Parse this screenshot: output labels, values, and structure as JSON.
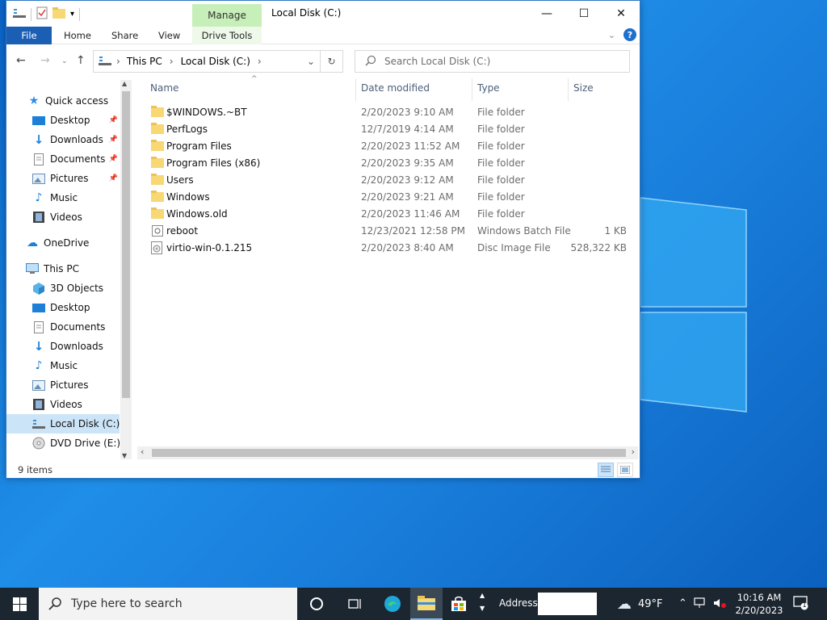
{
  "window": {
    "title": "Local Disk (C:)",
    "manage_tab": "Manage"
  },
  "ribbon": {
    "tabs": [
      "File",
      "Home",
      "Share",
      "View"
    ],
    "drive_tools": "Drive Tools"
  },
  "navigation": {
    "breadcrumb": [
      "This PC",
      "Local Disk (C:)"
    ],
    "search_placeholder": "Search Local Disk (C:)"
  },
  "nav_pane": {
    "quick_access": "Quick access",
    "quick_items": [
      "Desktop",
      "Downloads",
      "Documents",
      "Pictures",
      "Music",
      "Videos"
    ],
    "onedrive": "OneDrive",
    "this_pc": "This PC",
    "pc_items": [
      "3D Objects",
      "Desktop",
      "Documents",
      "Downloads",
      "Music",
      "Pictures",
      "Videos",
      "Local Disk (C:)",
      "DVD Drive (E:) A"
    ]
  },
  "columns": {
    "name": "Name",
    "date": "Date modified",
    "type": "Type",
    "size": "Size"
  },
  "files": [
    {
      "name": "$WINDOWS.~BT",
      "date": "2/20/2023 9:10 AM",
      "type": "File folder",
      "size": "",
      "kind": "folder"
    },
    {
      "name": "PerfLogs",
      "date": "12/7/2019 4:14 AM",
      "type": "File folder",
      "size": "",
      "kind": "folder"
    },
    {
      "name": "Program Files",
      "date": "2/20/2023 11:52 AM",
      "type": "File folder",
      "size": "",
      "kind": "folder"
    },
    {
      "name": "Program Files (x86)",
      "date": "2/20/2023 9:35 AM",
      "type": "File folder",
      "size": "",
      "kind": "folder"
    },
    {
      "name": "Users",
      "date": "2/20/2023 9:12 AM",
      "type": "File folder",
      "size": "",
      "kind": "folder"
    },
    {
      "name": "Windows",
      "date": "2/20/2023 9:21 AM",
      "type": "File folder",
      "size": "",
      "kind": "folder"
    },
    {
      "name": "Windows.old",
      "date": "2/20/2023 11:46 AM",
      "type": "File folder",
      "size": "",
      "kind": "folder"
    },
    {
      "name": "reboot",
      "date": "12/23/2021 12:58 PM",
      "type": "Windows Batch File",
      "size": "1 KB",
      "kind": "batch"
    },
    {
      "name": "virtio-win-0.1.215",
      "date": "2/20/2023 8:40 AM",
      "type": "Disc Image File",
      "size": "528,322 KB",
      "kind": "disc"
    }
  ],
  "status": {
    "item_count": "9 items"
  },
  "taskbar": {
    "search_placeholder": "Type here to search",
    "address_label": "Address",
    "weather": "49°F",
    "time": "10:16 AM",
    "date": "2/20/2023",
    "notification_count": "1"
  },
  "colors": {
    "accent": "#1a5fb4",
    "folder": "#f8d775",
    "manage_tab": "#c7efb9",
    "taskbar": "#1c2630"
  }
}
